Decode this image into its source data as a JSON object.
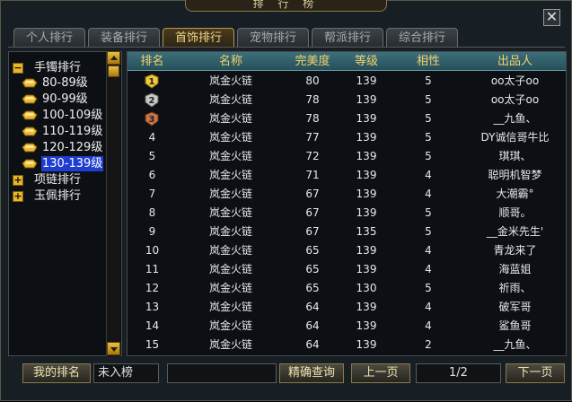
{
  "window": {
    "title": "排 行 榜",
    "close_glyph": "✕"
  },
  "tabs": [
    {
      "label": "个人排行",
      "active": false
    },
    {
      "label": "装备排行",
      "active": false
    },
    {
      "label": "首饰排行",
      "active": true
    },
    {
      "label": "宠物排行",
      "active": false
    },
    {
      "label": "帮派排行",
      "active": false
    },
    {
      "label": "综合排行",
      "active": false
    }
  ],
  "tree": {
    "bracelet": {
      "label": "手镯排行",
      "expander": "−"
    },
    "levels": [
      {
        "label": "80-89级",
        "selected": false
      },
      {
        "label": "90-99级",
        "selected": false
      },
      {
        "label": "100-109级",
        "selected": false
      },
      {
        "label": "110-119级",
        "selected": false
      },
      {
        "label": "120-129级",
        "selected": false
      },
      {
        "label": "130-139级",
        "selected": true
      }
    ],
    "necklace": {
      "label": "项链排行",
      "expander": "+"
    },
    "pendant": {
      "label": "玉佩排行",
      "expander": "+"
    }
  },
  "table": {
    "headers": [
      "排名",
      "名称",
      "完美度",
      "等级",
      "相性",
      "出品人"
    ],
    "rows": [
      {
        "rank": "1",
        "name": "岚金火链",
        "perfect": "80",
        "level": "139",
        "affinity": "5",
        "maker": "oo太子oo"
      },
      {
        "rank": "2",
        "name": "岚金火链",
        "perfect": "78",
        "level": "139",
        "affinity": "5",
        "maker": "oo太子oo"
      },
      {
        "rank": "3",
        "name": "岚金火链",
        "perfect": "78",
        "level": "139",
        "affinity": "5",
        "maker": "__九鱼、"
      },
      {
        "rank": "4",
        "name": "岚金火链",
        "perfect": "77",
        "level": "139",
        "affinity": "5",
        "maker": "DY诚信哥牛比"
      },
      {
        "rank": "5",
        "name": "岚金火链",
        "perfect": "72",
        "level": "139",
        "affinity": "5",
        "maker": "琪琪、"
      },
      {
        "rank": "6",
        "name": "岚金火链",
        "perfect": "71",
        "level": "139",
        "affinity": "4",
        "maker": "聪明机智梦"
      },
      {
        "rank": "7",
        "name": "岚金火链",
        "perfect": "67",
        "level": "139",
        "affinity": "4",
        "maker": "大潮霸°"
      },
      {
        "rank": "8",
        "name": "岚金火链",
        "perfect": "67",
        "level": "139",
        "affinity": "5",
        "maker": "顺哥。"
      },
      {
        "rank": "9",
        "name": "岚金火链",
        "perfect": "67",
        "level": "135",
        "affinity": "5",
        "maker": "__金米先生'"
      },
      {
        "rank": "10",
        "name": "岚金火链",
        "perfect": "65",
        "level": "139",
        "affinity": "4",
        "maker": "青龙来了"
      },
      {
        "rank": "11",
        "name": "岚金火链",
        "perfect": "65",
        "level": "139",
        "affinity": "4",
        "maker": "海蓝姐"
      },
      {
        "rank": "12",
        "name": "岚金火链",
        "perfect": "65",
        "level": "130",
        "affinity": "5",
        "maker": "祈雨、"
      },
      {
        "rank": "13",
        "name": "岚金火链",
        "perfect": "64",
        "level": "139",
        "affinity": "4",
        "maker": "破军哥"
      },
      {
        "rank": "14",
        "name": "岚金火链",
        "perfect": "64",
        "level": "139",
        "affinity": "4",
        "maker": "鲨鱼哥"
      },
      {
        "rank": "15",
        "name": "岚金火链",
        "perfect": "64",
        "level": "139",
        "affinity": "2",
        "maker": "__九鱼、"
      }
    ]
  },
  "bottom": {
    "my_rank_button": "我的排名",
    "my_rank_value": "未入榜",
    "search_value": "",
    "search_button": "精确查询",
    "prev_button": "上一页",
    "page_indicator": "1/2",
    "next_button": "下一页"
  },
  "colors": {
    "header_text": "#f5d36a",
    "selected_bg": "#1f3dd0",
    "gold": "#e9b62a"
  }
}
